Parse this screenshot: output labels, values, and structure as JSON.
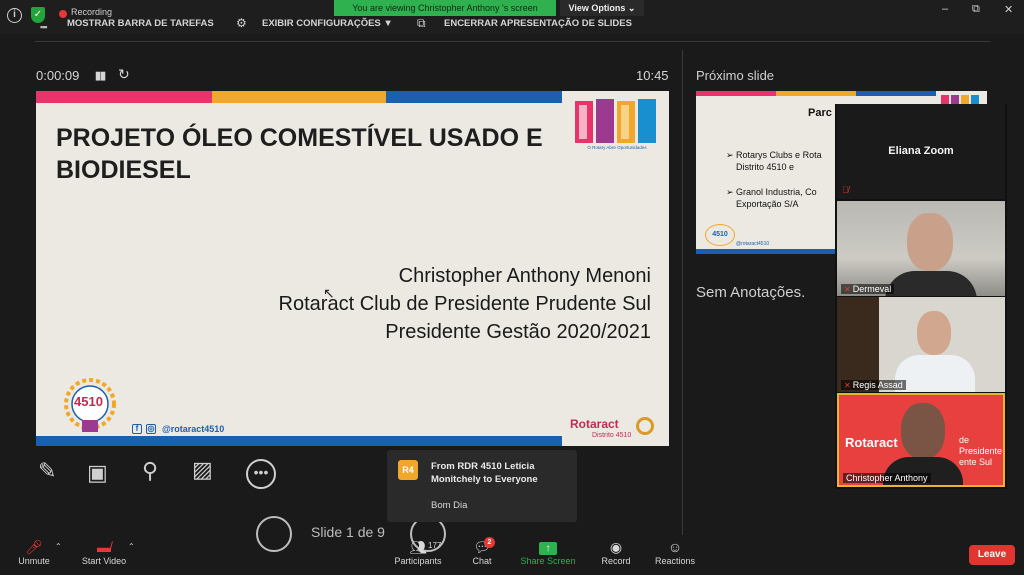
{
  "topbar": {
    "recording_label": "Recording",
    "hide_taskbar": "MOSTRAR BARRA DE TAREFAS",
    "display_settings": "EXIBIR CONFIGURAÇÕES ▼",
    "end_slideshow": "ENCERRAR APRESENTAÇÃO DE SLIDES",
    "viewing_banner": "You are viewing Christopher Anthony 's screen",
    "view_options": "View Options ⌄",
    "minimize": "–",
    "restore": "⧉",
    "close": "✕"
  },
  "presenter": {
    "elapsed": "0:00:09",
    "clock": "10:45",
    "next_slide_label": "Próximo slide",
    "notes": "Sem Anotações.",
    "pager": "Slide 1 de 9"
  },
  "slide": {
    "title": "PROJETO ÓLEO COMESTÍVEL USADO E BIODIESEL",
    "line1": "Christopher Anthony Menoni",
    "line2": "Rotaract Club de Presidente Prudente Sul",
    "line3": "Presidente Gestão 2020/2021",
    "doors_caption": "O Rotary Abre Oportunidades",
    "logo_number": "4510",
    "social_f": "f",
    "social_ig": "◎",
    "handle": "@rotaract4510",
    "brand": "Rotaract",
    "district": "Distrito 4510"
  },
  "next_slide": {
    "title": "Parc",
    "line1": "➢ Rotarys Clubs e Rota",
    "line2": "Distrito 4510 e",
    "line3": "➢ Granol Industria, Co",
    "line4": "Exportação S/A",
    "logo": "4510",
    "handle": "@rotaract4510"
  },
  "participants": [
    {
      "name": "Eliana Zoom"
    },
    {
      "name": "Dermeval"
    },
    {
      "name": "Regis Assad"
    },
    {
      "name": "Christopher Anthony"
    }
  ],
  "video_bg": {
    "brand": "Rotaract",
    "sub1": "de Presidente",
    "sub2": "ente Sul"
  },
  "chat_toast": {
    "avatar": "R4",
    "from": "From RDR 4510 Letícia Monitchely to Everyone",
    "message": "Bom Dia"
  },
  "toolbar": {
    "unmute": "Unmute",
    "start_video": "Start Video",
    "participants": "Participants",
    "participants_count": "177",
    "chat": "Chat",
    "chat_badge": "2",
    "share_screen": "Share Screen",
    "record": "Record",
    "reactions": "Reactions",
    "leave": "Leave"
  },
  "colors": {
    "accent_green": "#2fb150",
    "leave_red": "#e0362f",
    "stripe_pink": "#e8336b",
    "stripe_orange": "#f0a72a",
    "stripe_blue": "#1a5fb0"
  }
}
